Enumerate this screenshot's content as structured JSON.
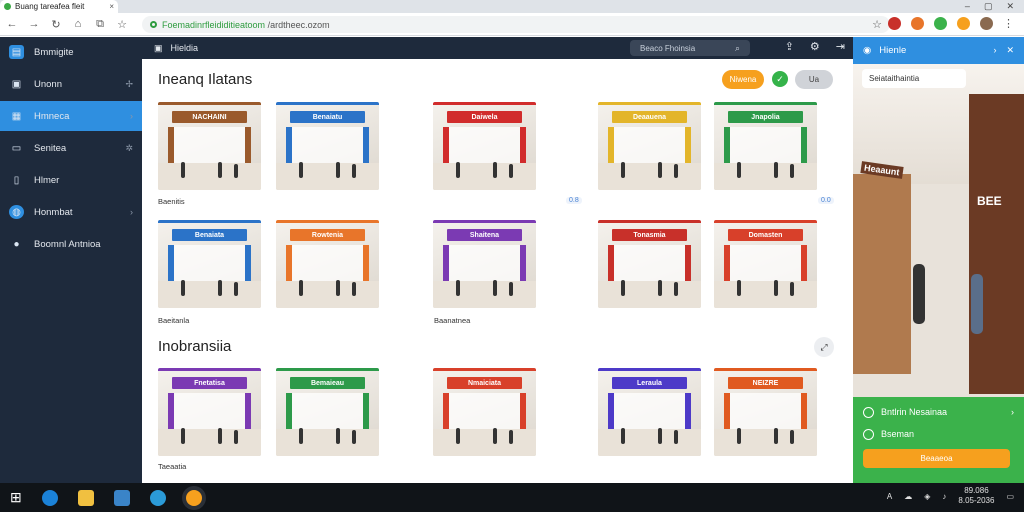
{
  "browser": {
    "tab_title": "Buang tareafea fleit",
    "url_host": "Foemadinrfleididitieatoom",
    "url_rest": " /ardtheec.ozom"
  },
  "app": {
    "header_title": "Hieldia",
    "search_placeholder": "Beaco Fhoinsia",
    "toolbar_icons": [
      "share-icon",
      "settings-icon",
      "exit-icon"
    ]
  },
  "sidebar": {
    "items": [
      {
        "label": "Bmmigite",
        "icon": "dashboard-icon",
        "active": false
      },
      {
        "label": "Unonn",
        "icon": "users-icon",
        "active": false
      },
      {
        "label": "Hmneca",
        "icon": "shop-icon",
        "active": true
      },
      {
        "label": "Senitea",
        "icon": "store-icon",
        "active": false
      },
      {
        "label": "Hlmer",
        "icon": "document-icon",
        "active": false
      },
      {
        "label": "Honmbat",
        "icon": "globe-icon",
        "active": false
      },
      {
        "label": "Boomnl Antnioa",
        "icon": "person-icon",
        "active": false
      }
    ]
  },
  "main": {
    "section1_title": "Ineanq Ilatans",
    "pill_orange": "Niwena",
    "pill_grey": "Ua",
    "section2_title": "Inobransiia",
    "row1": [
      {
        "sign": "NACHAINI",
        "accent": "#9a5a2c"
      },
      {
        "sign": "Benaiatu",
        "accent": "#2b73c8"
      },
      {
        "sign": "Daiwela",
        "accent": "#d12c2c"
      },
      {
        "sign": "Deaauena",
        "accent": "#e3b52a"
      },
      {
        "sign": "Jnapolia",
        "accent": "#2d9a4a"
      }
    ],
    "row2": [
      {
        "sign": "Benaiata",
        "accent": "#2b73c8"
      },
      {
        "sign": "Rowtenia",
        "accent": "#e8752a"
      },
      {
        "sign": "Shaitena",
        "accent": "#7b3ab3"
      },
      {
        "sign": "Tonasmia",
        "accent": "#c8302a"
      },
      {
        "sign": "Domasten",
        "accent": "#d8402a"
      }
    ],
    "row3": [
      {
        "sign": "Fnetatisa",
        "accent": "#7b3ab3"
      },
      {
        "sign": "Bemaieau",
        "accent": "#2d9a4a"
      },
      {
        "sign": "Nmaiciata",
        "accent": "#d8402a"
      },
      {
        "sign": "Leraula",
        "accent": "#4d3ac8"
      },
      {
        "sign": "NEIZRE",
        "accent": "#e05a20"
      }
    ],
    "cap_row1": "Baenitis",
    "tag_row1": "0.8",
    "tag_row1b": "0.0",
    "cap_row2a": "Baeitanla",
    "cap_row2b": "Baanatnea",
    "cap_row3": "Taeaatia"
  },
  "right_panel": {
    "header": "Hienle",
    "search_value": "Seiataithaintia",
    "store_sign": "BEE",
    "store_sign2": "Heaaunt",
    "row1": "Bntlrin Nesainaa",
    "row2": "Bseman",
    "button": "Beaaeoa"
  },
  "taskbar": {
    "time": "89.086",
    "date": "8.05-2036",
    "lang": "A"
  },
  "colors": {
    "sidebar_bg": "#1e2a3c",
    "accent_blue": "#2f8fe0",
    "accent_orange": "#f6a01e",
    "accent_green": "#3bb24b"
  }
}
